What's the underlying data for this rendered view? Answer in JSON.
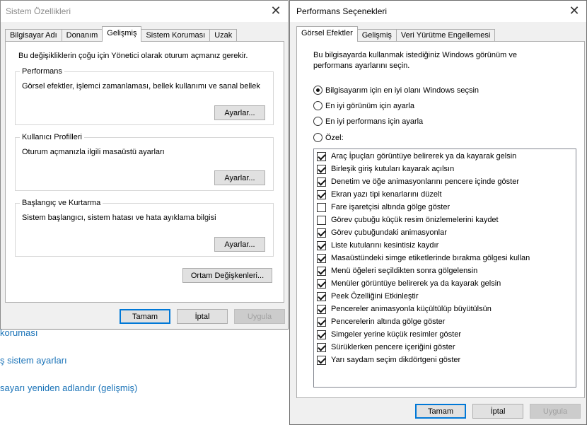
{
  "background": {
    "links": [
      "koruması",
      "ş sistem ayarları",
      "sayarı yeniden adlandır (gelişmiş)"
    ]
  },
  "system_properties": {
    "title": "Sistem Özellikleri",
    "tabs": [
      "Bilgisayar Adı",
      "Donanım",
      "Gelişmiş",
      "Sistem Koruması",
      "Uzak"
    ],
    "active_tab": "Gelişmiş",
    "admin_note": "Bu değişikliklerin çoğu için Yönetici olarak oturum açmanız gerekir.",
    "groups": [
      {
        "title": "Performans",
        "desc": "Görsel efektler, işlemci zamanlaması, bellek kullanımı ve sanal bellek",
        "button": "Ayarlar..."
      },
      {
        "title": "Kullanıcı Profilleri",
        "desc": "Oturum açmanızla ilgili masaüstü ayarları",
        "button": "Ayarlar..."
      },
      {
        "title": "Başlangıç ve Kurtarma",
        "desc": "Sistem başlangıcı, sistem hatası ve hata ayıklama bilgisi",
        "button": "Ayarlar..."
      }
    ],
    "env_button": "Ortam Değişkenleri...",
    "ok": "Tamam",
    "cancel": "İptal",
    "apply": "Uygula"
  },
  "performance_options": {
    "title": "Performans Seçenekleri",
    "tabs": [
      "Görsel Efektler",
      "Gelişmiş",
      "Veri Yürütme Engellemesi"
    ],
    "active_tab": "Görsel Efektler",
    "intro": [
      "Bu bilgisayarda kullanmak istediğiniz Windows görünüm ve",
      "performans ayarlarını seçin."
    ],
    "radios": [
      {
        "label": "Bilgisayarım için en iyi olanı Windows seçsin",
        "checked": true
      },
      {
        "label": "En iyi görünüm için ayarla",
        "checked": false
      },
      {
        "label": "En iyi performans için ayarla",
        "checked": false
      },
      {
        "label": "Özel:",
        "checked": false
      }
    ],
    "effects": [
      {
        "label": "Araç İpuçları görüntüye belirerek ya da kayarak gelsin",
        "checked": true
      },
      {
        "label": "Birleşik giriş kutuları kayarak açılsın",
        "checked": true
      },
      {
        "label": "Denetim ve öğe animasyonlarını pencere içinde göster",
        "checked": true
      },
      {
        "label": "Ekran yazı tipi kenarlarını düzelt",
        "checked": true
      },
      {
        "label": "Fare işaretçisi altında gölge göster",
        "checked": false
      },
      {
        "label": "Görev çubuğu küçük resim önizlemelerini kaydet",
        "checked": false
      },
      {
        "label": "Görev çubuğundaki animasyonlar",
        "checked": true
      },
      {
        "label": "Liste kutularını kesintisiz kaydır",
        "checked": true
      },
      {
        "label": "Masaüstündeki simge etiketlerinde bırakma gölgesi kullan",
        "checked": true
      },
      {
        "label": "Menü öğeleri seçildikten sonra gölgelensin",
        "checked": true
      },
      {
        "label": "Menüler görüntüye belirerek ya da kayarak gelsin",
        "checked": true
      },
      {
        "label": "Peek Özelliğini Etkinleştir",
        "checked": true
      },
      {
        "label": "Pencereler animasyonla küçültülüp büyütülsün",
        "checked": true
      },
      {
        "label": "Pencerelerin altında gölge göster",
        "checked": true
      },
      {
        "label": "Simgeler yerine küçük resimler göster",
        "checked": true
      },
      {
        "label": "Sürüklerken pencere içeriğini göster",
        "checked": true
      },
      {
        "label": "Yarı saydam seçim dikdörtgeni göster",
        "checked": true
      }
    ],
    "ok": "Tamam",
    "cancel": "İptal",
    "apply": "Uygula"
  }
}
